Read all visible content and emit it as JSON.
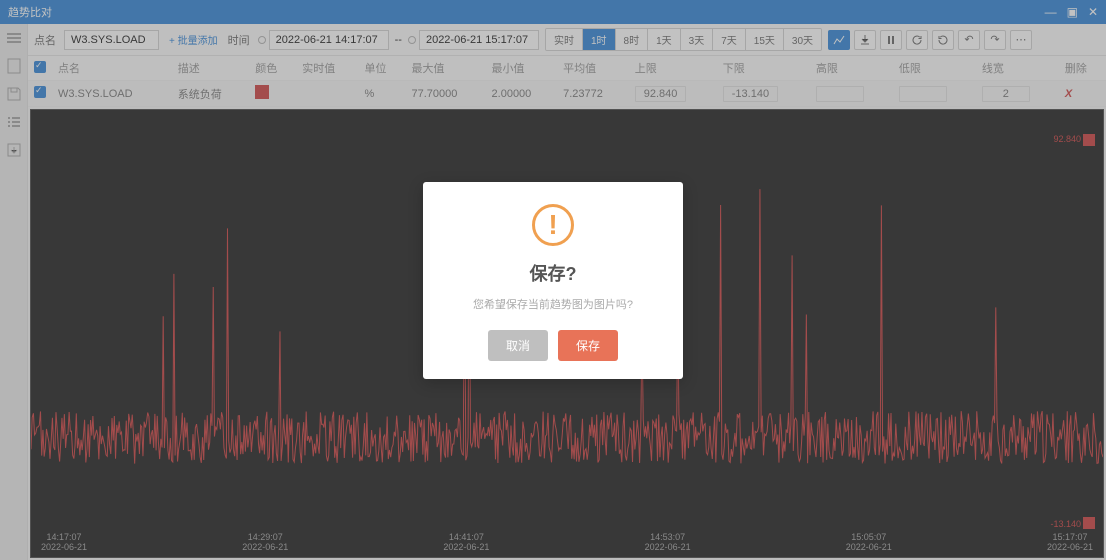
{
  "window": {
    "title": "趋势比对"
  },
  "toolbar": {
    "point_label": "点名",
    "point_value": "W3.SYS.LOAD",
    "batch_add": "+ 批量添加",
    "time_label": "时间",
    "time_start": "2022-06-21 14:17:07",
    "sep": "--",
    "time_end": "2022-06-21 15:17:07",
    "ranges": [
      "实时",
      "1时",
      "8时",
      "1天",
      "3天",
      "7天",
      "15天",
      "30天"
    ]
  },
  "table": {
    "headers": {
      "name": "点名",
      "desc": "描述",
      "color": "颜色",
      "realtime": "实时值",
      "unit": "单位",
      "max": "最大值",
      "min": "最小值",
      "avg": "平均值",
      "upper": "上限",
      "lower": "下限",
      "highhigh": "高限",
      "lowlow": "低限",
      "lw": "线宽",
      "del": "删除"
    },
    "row": {
      "name": "W3.SYS.LOAD",
      "desc": "系统负荷",
      "unit": "%",
      "max": "77.70000",
      "min": "2.00000",
      "avg": "7.23772",
      "upper": "92.840",
      "lower": "-13.140",
      "lw": "2"
    }
  },
  "chart_data": {
    "type": "line",
    "title": "",
    "xlabel": "",
    "ylabel": "",
    "ylim": [
      -13.14,
      92.84
    ],
    "upper_label": "92.840",
    "lower_label": "-13.140",
    "xticks": [
      {
        "time": "14:17:07",
        "date": "2022-06-21"
      },
      {
        "time": "14:29:07",
        "date": "2022-06-21"
      },
      {
        "time": "14:41:07",
        "date": "2022-06-21"
      },
      {
        "time": "14:53:07",
        "date": "2022-06-21"
      },
      {
        "time": "15:05:07",
        "date": "2022-06-21"
      },
      {
        "time": "15:17:07",
        "date": "2022-06-21"
      }
    ],
    "series": [
      {
        "name": "W3.SYS.LOAD",
        "color": "#c62828",
        "baseline": 6,
        "noise_amp": 15,
        "spike_max": 77.7
      }
    ]
  },
  "dialog": {
    "title": "保存?",
    "message": "您希望保存当前趋势图为图片吗?",
    "cancel": "取消",
    "confirm": "保存"
  }
}
